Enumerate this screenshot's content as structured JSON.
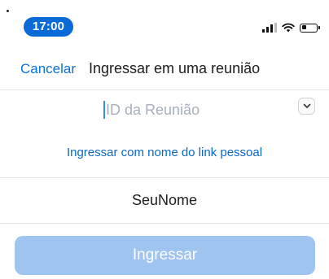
{
  "status_bar": {
    "time": "17:00",
    "icons": [
      "cellular-signal-icon",
      "wifi-icon",
      "battery-icon"
    ]
  },
  "nav": {
    "cancel_label": "Cancelar",
    "title": "Ingressar em uma reunião"
  },
  "meeting_id": {
    "placeholder": "ID da Reunião",
    "value": "",
    "dropdown_icon": "chevron-down-icon"
  },
  "personal_link_label": "Ingressar com nome do link pessoal",
  "name_field": {
    "value": "SeuNome"
  },
  "join_button_label": "Ingressar",
  "colors": {
    "accent": "#0b72d8",
    "time_pill": "#0b6bd6",
    "join_button_disabled": "#9ec4ef",
    "placeholder": "#a8b0bd"
  }
}
